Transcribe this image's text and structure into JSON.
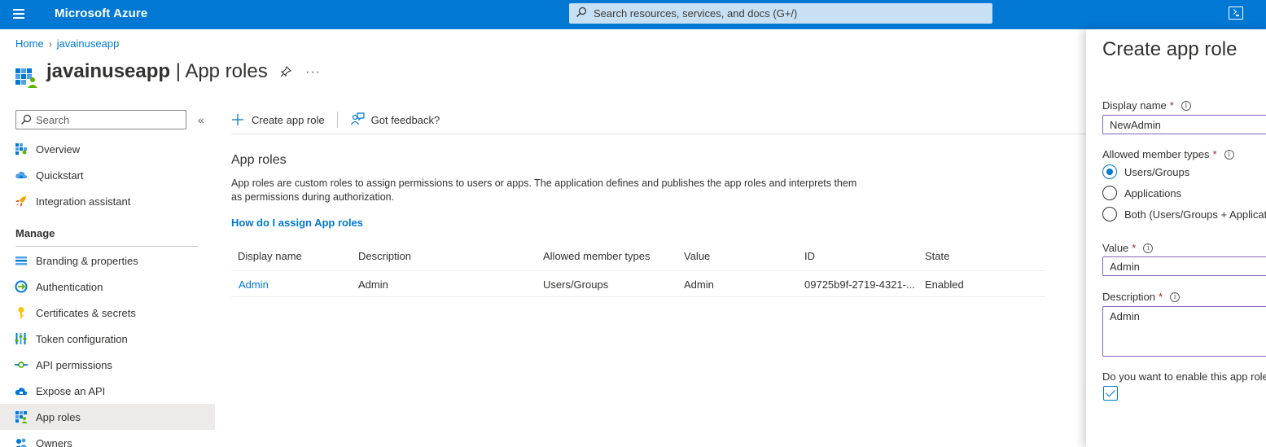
{
  "topbar": {
    "brand": "Microsoft Azure",
    "search_placeholder": "Search resources, services, and docs (G+/)"
  },
  "breadcrumb": {
    "home": "Home",
    "app": "javainuseapp"
  },
  "title": {
    "app_name": "javainuseapp",
    "separator": " | ",
    "page": "App roles"
  },
  "nav": {
    "search_placeholder": "Search",
    "collapse": "«",
    "items_top": [
      {
        "label": "Overview",
        "icon": "overview-icon"
      },
      {
        "label": "Quickstart",
        "icon": "cloud-icon"
      },
      {
        "label": "Integration assistant",
        "icon": "rocket-icon"
      }
    ],
    "section": "Manage",
    "items_manage": [
      {
        "label": "Branding & properties",
        "icon": "branding-icon"
      },
      {
        "label": "Authentication",
        "icon": "authentication-icon"
      },
      {
        "label": "Certificates & secrets",
        "icon": "key-icon"
      },
      {
        "label": "Token configuration",
        "icon": "token-icon"
      },
      {
        "label": "API permissions",
        "icon": "api-permissions-icon"
      },
      {
        "label": "Expose an API",
        "icon": "cloud-api-icon"
      },
      {
        "label": "App roles",
        "icon": "app-roles-icon"
      },
      {
        "label": "Owners",
        "icon": "owners-icon"
      }
    ],
    "active": "App roles"
  },
  "commandbar": {
    "create": "Create app role",
    "feedback": "Got feedback?"
  },
  "main": {
    "heading": "App roles",
    "description_line1": "App roles are custom roles to assign permissions to users or apps. The application defines and publishes the app roles and interprets them",
    "description_line2": "as permissions during authorization.",
    "howto_link": "How do I assign App roles"
  },
  "table": {
    "columns": [
      "Display name",
      "Description",
      "Allowed member types",
      "Value",
      "ID",
      "State"
    ],
    "rows": [
      [
        "Admin",
        "Admin",
        "Users/Groups",
        "Admin",
        "09725b9f-2719-4321-...",
        "Enabled"
      ]
    ]
  },
  "panel": {
    "title": "Create app role",
    "display_name_label": "Display name",
    "display_name_value": "NewAdmin",
    "member_types_label": "Allowed member types",
    "member_types": [
      "Users/Groups",
      "Applications",
      "Both (Users/Groups + Applications)"
    ],
    "member_types_selected": "Users/Groups",
    "value_label": "Value",
    "value_value": "Admin",
    "description_label": "Description",
    "description_value": "Admin",
    "enable_label": "Do you want to enable this app role?",
    "enable_checked": true,
    "required_mark": "*",
    "info_glyph": "i"
  },
  "colors": {
    "accent": "#0078d4",
    "topbar": "#0078d4",
    "search_bg": "#c7e0f4",
    "required": "#a4262c",
    "input_border": "#8764b8"
  }
}
